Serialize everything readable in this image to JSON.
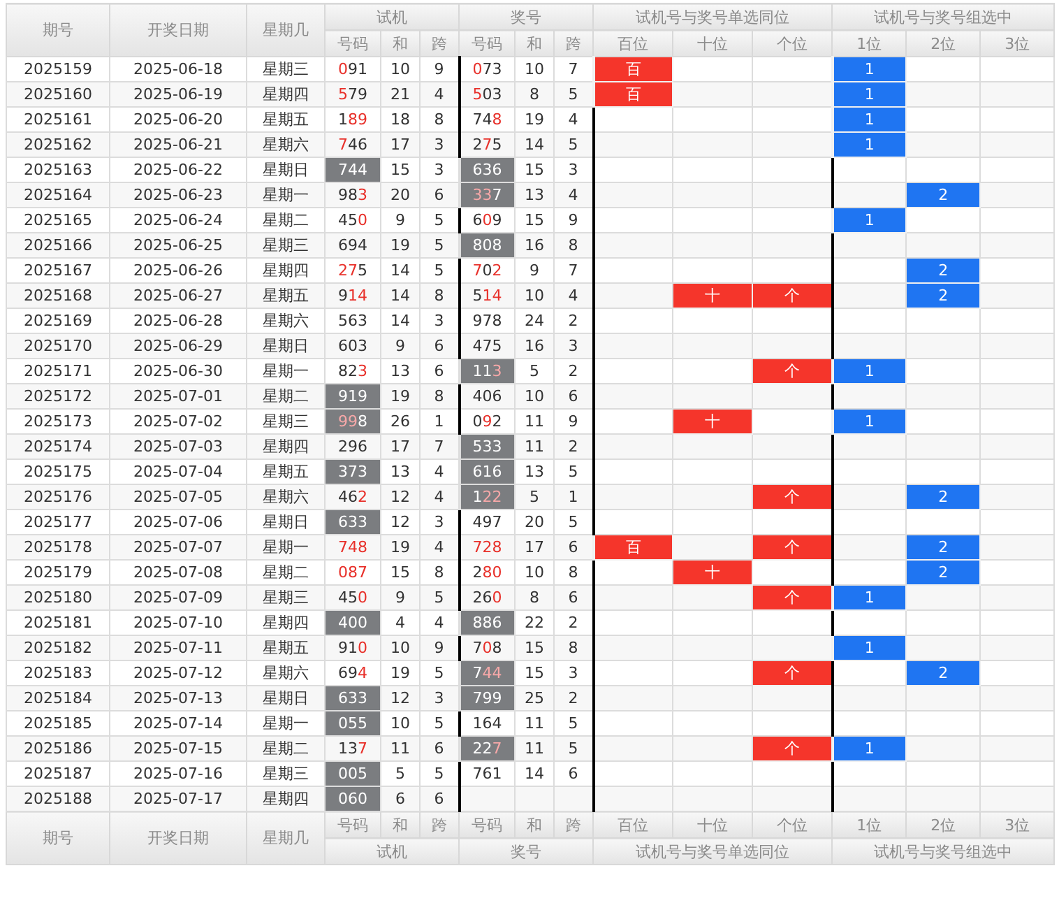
{
  "header": {
    "groups": [
      {
        "label": "期号"
      },
      {
        "label": "开奖日期"
      },
      {
        "label": "星期几"
      },
      {
        "label": "试机",
        "columns": [
          "号码",
          "和",
          "跨"
        ]
      },
      {
        "label": "奖号",
        "columns": [
          "号码",
          "和",
          "跨"
        ]
      },
      {
        "label": "试机号与奖号单选同位",
        "columns": [
          "百位",
          "十位",
          "个位"
        ]
      },
      {
        "label": "试机号与奖号组选中",
        "columns": [
          "1位",
          "2位",
          "3位"
        ]
      }
    ]
  },
  "rows": [
    {
      "period": "2025159",
      "date": "2025-06-18",
      "weekday": "星期三",
      "test": {
        "number": "091",
        "hits": [
          true,
          false,
          false
        ],
        "sum": "10",
        "span": "9",
        "shaded": false
      },
      "draw": {
        "number": "073",
        "hits": [
          true,
          false,
          false
        ],
        "sum": "10",
        "span": "7",
        "shaded": false
      },
      "same_position": [
        {
          "kind": "hundreds",
          "label": "百"
        }
      ],
      "group": [
        {
          "kind": "first",
          "label": "1"
        }
      ]
    },
    {
      "period": "2025160",
      "date": "2025-06-19",
      "weekday": "星期四",
      "test": {
        "number": "579",
        "hits": [
          true,
          false,
          false
        ],
        "sum": "21",
        "span": "4",
        "shaded": false
      },
      "draw": {
        "number": "503",
        "hits": [
          true,
          false,
          false
        ],
        "sum": "8",
        "span": "5",
        "shaded": false
      },
      "same_position": [
        {
          "kind": "hundreds",
          "label": "百"
        }
      ],
      "group": [
        {
          "kind": "first",
          "label": "1"
        }
      ]
    },
    {
      "period": "2025161",
      "date": "2025-06-20",
      "weekday": "星期五",
      "test": {
        "number": "189",
        "hits": [
          false,
          true,
          true
        ],
        "sum": "18",
        "span": "8",
        "shaded": false
      },
      "draw": {
        "number": "748",
        "hits": [
          false,
          false,
          true
        ],
        "sum": "19",
        "span": "4",
        "shaded": false
      },
      "group": [
        {
          "kind": "first",
          "label": "1"
        }
      ]
    },
    {
      "period": "2025162",
      "date": "2025-06-21",
      "weekday": "星期六",
      "test": {
        "number": "746",
        "hits": [
          true,
          false,
          false
        ],
        "sum": "17",
        "span": "3",
        "shaded": false
      },
      "draw": {
        "number": "275",
        "hits": [
          false,
          true,
          false
        ],
        "sum": "14",
        "span": "5",
        "shaded": false
      },
      "group": [
        {
          "kind": "first",
          "label": "1"
        }
      ]
    },
    {
      "period": "2025163",
      "date": "2025-06-22",
      "weekday": "星期日",
      "test": {
        "number": "744",
        "hits": [
          false,
          false,
          false
        ],
        "sum": "15",
        "span": "3",
        "shaded": true
      },
      "draw": {
        "number": "636",
        "hits": [
          false,
          false,
          false
        ],
        "sum": "15",
        "span": "3",
        "shaded": true
      }
    },
    {
      "period": "2025164",
      "date": "2025-06-23",
      "weekday": "星期一",
      "test": {
        "number": "983",
        "hits": [
          false,
          false,
          true
        ],
        "sum": "20",
        "span": "6",
        "shaded": false
      },
      "draw": {
        "number": "337",
        "hits": [
          true,
          true,
          false
        ],
        "sum": "13",
        "span": "4",
        "shaded": true
      },
      "group": [
        {
          "kind": "second",
          "label": "2"
        }
      ]
    },
    {
      "period": "2025165",
      "date": "2025-06-24",
      "weekday": "星期二",
      "test": {
        "number": "450",
        "hits": [
          false,
          false,
          true
        ],
        "sum": "9",
        "span": "5",
        "shaded": false
      },
      "draw": {
        "number": "609",
        "hits": [
          false,
          true,
          false
        ],
        "sum": "15",
        "span": "9",
        "shaded": false
      },
      "group": [
        {
          "kind": "first",
          "label": "1"
        }
      ]
    },
    {
      "period": "2025166",
      "date": "2025-06-25",
      "weekday": "星期三",
      "test": {
        "number": "694",
        "hits": [
          false,
          false,
          false
        ],
        "sum": "19",
        "span": "5",
        "shaded": false
      },
      "draw": {
        "number": "808",
        "hits": [
          false,
          false,
          false
        ],
        "sum": "16",
        "span": "8",
        "shaded": true
      }
    },
    {
      "period": "2025167",
      "date": "2025-06-26",
      "weekday": "星期四",
      "test": {
        "number": "275",
        "hits": [
          true,
          true,
          false
        ],
        "sum": "14",
        "span": "5",
        "shaded": false
      },
      "draw": {
        "number": "702",
        "hits": [
          true,
          false,
          true
        ],
        "sum": "9",
        "span": "7",
        "shaded": false
      },
      "group": [
        {
          "kind": "second",
          "label": "2"
        }
      ]
    },
    {
      "period": "2025168",
      "date": "2025-06-27",
      "weekday": "星期五",
      "test": {
        "number": "914",
        "hits": [
          false,
          true,
          true
        ],
        "sum": "14",
        "span": "8",
        "shaded": false
      },
      "draw": {
        "number": "514",
        "hits": [
          false,
          true,
          true
        ],
        "sum": "10",
        "span": "4",
        "shaded": false
      },
      "same_position": [
        {
          "kind": "tens",
          "label": "十"
        },
        {
          "kind": "ones",
          "label": "个"
        }
      ],
      "group": [
        {
          "kind": "second",
          "label": "2"
        }
      ]
    },
    {
      "period": "2025169",
      "date": "2025-06-28",
      "weekday": "星期六",
      "test": {
        "number": "563",
        "hits": [
          false,
          false,
          false
        ],
        "sum": "14",
        "span": "3",
        "shaded": false
      },
      "draw": {
        "number": "978",
        "hits": [
          false,
          false,
          false
        ],
        "sum": "24",
        "span": "2",
        "shaded": false
      }
    },
    {
      "period": "2025170",
      "date": "2025-06-29",
      "weekday": "星期日",
      "test": {
        "number": "603",
        "hits": [
          false,
          false,
          false
        ],
        "sum": "9",
        "span": "6",
        "shaded": false
      },
      "draw": {
        "number": "475",
        "hits": [
          false,
          false,
          false
        ],
        "sum": "16",
        "span": "3",
        "shaded": false
      }
    },
    {
      "period": "2025171",
      "date": "2025-06-30",
      "weekday": "星期一",
      "test": {
        "number": "823",
        "hits": [
          false,
          false,
          true
        ],
        "sum": "13",
        "span": "6",
        "shaded": false
      },
      "draw": {
        "number": "113",
        "hits": [
          false,
          false,
          true
        ],
        "sum": "5",
        "span": "2",
        "shaded": true
      },
      "same_position": [
        {
          "kind": "ones",
          "label": "个"
        }
      ],
      "group": [
        {
          "kind": "first",
          "label": "1"
        }
      ]
    },
    {
      "period": "2025172",
      "date": "2025-07-01",
      "weekday": "星期二",
      "test": {
        "number": "919",
        "hits": [
          false,
          false,
          false
        ],
        "sum": "19",
        "span": "8",
        "shaded": true
      },
      "draw": {
        "number": "406",
        "hits": [
          false,
          false,
          false
        ],
        "sum": "10",
        "span": "6",
        "shaded": false
      }
    },
    {
      "period": "2025173",
      "date": "2025-07-02",
      "weekday": "星期三",
      "test": {
        "number": "998",
        "hits": [
          true,
          true,
          false
        ],
        "sum": "26",
        "span": "1",
        "shaded": true
      },
      "draw": {
        "number": "092",
        "hits": [
          false,
          true,
          false
        ],
        "sum": "11",
        "span": "9",
        "shaded": false
      },
      "same_position": [
        {
          "kind": "tens",
          "label": "十"
        }
      ],
      "group": [
        {
          "kind": "first",
          "label": "1"
        }
      ]
    },
    {
      "period": "2025174",
      "date": "2025-07-03",
      "weekday": "星期四",
      "test": {
        "number": "296",
        "hits": [
          false,
          false,
          false
        ],
        "sum": "17",
        "span": "7",
        "shaded": false
      },
      "draw": {
        "number": "533",
        "hits": [
          false,
          false,
          false
        ],
        "sum": "11",
        "span": "2",
        "shaded": true
      }
    },
    {
      "period": "2025175",
      "date": "2025-07-04",
      "weekday": "星期五",
      "test": {
        "number": "373",
        "hits": [
          false,
          false,
          false
        ],
        "sum": "13",
        "span": "4",
        "shaded": true
      },
      "draw": {
        "number": "616",
        "hits": [
          false,
          false,
          false
        ],
        "sum": "13",
        "span": "5",
        "shaded": true
      }
    },
    {
      "period": "2025176",
      "date": "2025-07-05",
      "weekday": "星期六",
      "test": {
        "number": "462",
        "hits": [
          false,
          false,
          true
        ],
        "sum": "12",
        "span": "4",
        "shaded": false
      },
      "draw": {
        "number": "122",
        "hits": [
          false,
          true,
          true
        ],
        "sum": "5",
        "span": "1",
        "shaded": true
      },
      "same_position": [
        {
          "kind": "ones",
          "label": "个"
        }
      ],
      "group": [
        {
          "kind": "second",
          "label": "2"
        }
      ]
    },
    {
      "period": "2025177",
      "date": "2025-07-06",
      "weekday": "星期日",
      "test": {
        "number": "633",
        "hits": [
          false,
          false,
          false
        ],
        "sum": "12",
        "span": "3",
        "shaded": true
      },
      "draw": {
        "number": "497",
        "hits": [
          false,
          false,
          false
        ],
        "sum": "20",
        "span": "5",
        "shaded": false
      }
    },
    {
      "period": "2025178",
      "date": "2025-07-07",
      "weekday": "星期一",
      "test": {
        "number": "748",
        "hits": [
          true,
          true,
          true
        ],
        "sum": "19",
        "span": "4",
        "shaded": false
      },
      "draw": {
        "number": "728",
        "hits": [
          true,
          true,
          true
        ],
        "sum": "17",
        "span": "6",
        "shaded": false
      },
      "same_position": [
        {
          "kind": "hundreds",
          "label": "百"
        },
        {
          "kind": "ones",
          "label": "个"
        }
      ],
      "group": [
        {
          "kind": "second",
          "label": "2"
        }
      ]
    },
    {
      "period": "2025179",
      "date": "2025-07-08",
      "weekday": "星期二",
      "test": {
        "number": "087",
        "hits": [
          true,
          true,
          true
        ],
        "sum": "15",
        "span": "8",
        "shaded": false
      },
      "draw": {
        "number": "280",
        "hits": [
          false,
          true,
          true
        ],
        "sum": "10",
        "span": "8",
        "shaded": false
      },
      "same_position": [
        {
          "kind": "tens",
          "label": "十"
        }
      ],
      "group": [
        {
          "kind": "second",
          "label": "2"
        }
      ]
    },
    {
      "period": "2025180",
      "date": "2025-07-09",
      "weekday": "星期三",
      "test": {
        "number": "450",
        "hits": [
          false,
          false,
          true
        ],
        "sum": "9",
        "span": "5",
        "shaded": false
      },
      "draw": {
        "number": "260",
        "hits": [
          false,
          false,
          true
        ],
        "sum": "8",
        "span": "6",
        "shaded": false
      },
      "same_position": [
        {
          "kind": "ones",
          "label": "个"
        }
      ],
      "group": [
        {
          "kind": "first",
          "label": "1"
        }
      ]
    },
    {
      "period": "2025181",
      "date": "2025-07-10",
      "weekday": "星期四",
      "test": {
        "number": "400",
        "hits": [
          false,
          false,
          false
        ],
        "sum": "4",
        "span": "4",
        "shaded": true
      },
      "draw": {
        "number": "886",
        "hits": [
          false,
          false,
          false
        ],
        "sum": "22",
        "span": "2",
        "shaded": true
      }
    },
    {
      "period": "2025182",
      "date": "2025-07-11",
      "weekday": "星期五",
      "test": {
        "number": "910",
        "hits": [
          false,
          false,
          true
        ],
        "sum": "10",
        "span": "9",
        "shaded": false
      },
      "draw": {
        "number": "708",
        "hits": [
          false,
          true,
          false
        ],
        "sum": "15",
        "span": "8",
        "shaded": false
      },
      "group": [
        {
          "kind": "first",
          "label": "1"
        }
      ]
    },
    {
      "period": "2025183",
      "date": "2025-07-12",
      "weekday": "星期六",
      "test": {
        "number": "694",
        "hits": [
          false,
          false,
          true
        ],
        "sum": "19",
        "span": "5",
        "shaded": false
      },
      "draw": {
        "number": "744",
        "hits": [
          false,
          true,
          true
        ],
        "sum": "15",
        "span": "3",
        "shaded": true
      },
      "same_position": [
        {
          "kind": "ones",
          "label": "个"
        }
      ],
      "group": [
        {
          "kind": "second",
          "label": "2"
        }
      ]
    },
    {
      "period": "2025184",
      "date": "2025-07-13",
      "weekday": "星期日",
      "test": {
        "number": "633",
        "hits": [
          false,
          false,
          false
        ],
        "sum": "12",
        "span": "3",
        "shaded": true
      },
      "draw": {
        "number": "799",
        "hits": [
          false,
          false,
          false
        ],
        "sum": "25",
        "span": "2",
        "shaded": true
      }
    },
    {
      "period": "2025185",
      "date": "2025-07-14",
      "weekday": "星期一",
      "test": {
        "number": "055",
        "hits": [
          false,
          false,
          false
        ],
        "sum": "10",
        "span": "5",
        "shaded": true
      },
      "draw": {
        "number": "164",
        "hits": [
          false,
          false,
          false
        ],
        "sum": "11",
        "span": "5",
        "shaded": false
      }
    },
    {
      "period": "2025186",
      "date": "2025-07-15",
      "weekday": "星期二",
      "test": {
        "number": "137",
        "hits": [
          false,
          false,
          true
        ],
        "sum": "11",
        "span": "6",
        "shaded": false
      },
      "draw": {
        "number": "227",
        "hits": [
          false,
          false,
          true
        ],
        "sum": "11",
        "span": "5",
        "shaded": true
      },
      "same_position": [
        {
          "kind": "ones",
          "label": "个"
        }
      ],
      "group": [
        {
          "kind": "first",
          "label": "1"
        }
      ]
    },
    {
      "period": "2025187",
      "date": "2025-07-16",
      "weekday": "星期三",
      "test": {
        "number": "005",
        "hits": [
          false,
          false,
          false
        ],
        "sum": "5",
        "span": "5",
        "shaded": true
      },
      "draw": {
        "number": "761",
        "hits": [
          false,
          false,
          false
        ],
        "sum": "14",
        "span": "6",
        "shaded": false
      }
    },
    {
      "period": "2025188",
      "date": "2025-07-17",
      "weekday": "星期四",
      "test": {
        "number": "060",
        "hits": [
          false,
          false,
          false
        ],
        "sum": "6",
        "span": "6",
        "shaded": true
      }
    }
  ],
  "footer": {
    "groups": [
      {
        "label": "期号"
      },
      {
        "label": "开奖日期"
      },
      {
        "label": "星期几"
      },
      {
        "label": "试机",
        "columns": [
          "号码",
          "和",
          "跨"
        ]
      },
      {
        "label": "奖号",
        "columns": [
          "号码",
          "和",
          "跨"
        ]
      },
      {
        "label": "试机号与奖号单选同位",
        "columns": [
          "百位",
          "十位",
          "个位"
        ]
      },
      {
        "label": "试机号与奖号组选中",
        "columns": [
          "1位",
          "2位",
          "3位"
        ]
      }
    ]
  }
}
